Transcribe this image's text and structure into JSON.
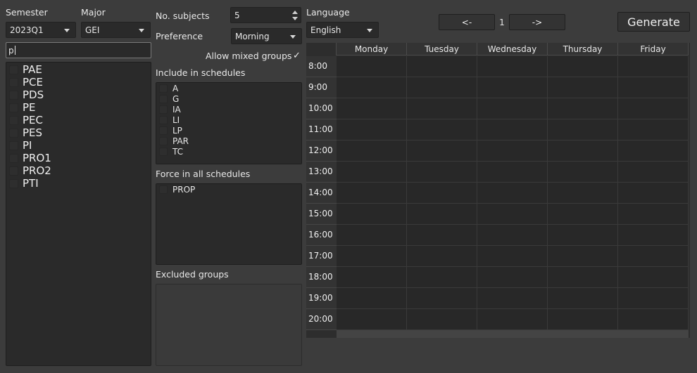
{
  "semester": {
    "label": "Semester",
    "value": "2023Q1"
  },
  "major": {
    "label": "Major",
    "value": "GEI"
  },
  "search": {
    "value": "p"
  },
  "subjects": [
    "PAE",
    "PCE",
    "PDS",
    "PE",
    "PEC",
    "PES",
    "PI",
    "PRO1",
    "PRO2",
    "PTI"
  ],
  "num_subjects": {
    "label": "No. subjects",
    "value": "5"
  },
  "preference": {
    "label": "Preference",
    "value": "Morning"
  },
  "mixed_groups": {
    "label": "Allow mixed groups",
    "checked": true,
    "check_glyph": "✓"
  },
  "include": {
    "label": "Include in schedules",
    "items": [
      "A",
      "G",
      "IA",
      "LI",
      "LP",
      "PAR",
      "TC"
    ]
  },
  "force": {
    "label": "Force in all schedules",
    "items": [
      "PROP"
    ]
  },
  "excluded": {
    "label": "Excluded groups",
    "items": []
  },
  "language": {
    "label": "Language",
    "value": "English"
  },
  "pager": {
    "prev_label": "<-",
    "page": "1",
    "next_label": "->"
  },
  "generate_label": "Generate",
  "schedule": {
    "days": [
      "Monday",
      "Tuesday",
      "Wednesday",
      "Thursday",
      "Friday"
    ],
    "hours": [
      "8:00",
      "9:00",
      "10:00",
      "11:00",
      "12:00",
      "13:00",
      "14:00",
      "15:00",
      "16:00",
      "17:00",
      "18:00",
      "19:00",
      "20:00"
    ]
  }
}
